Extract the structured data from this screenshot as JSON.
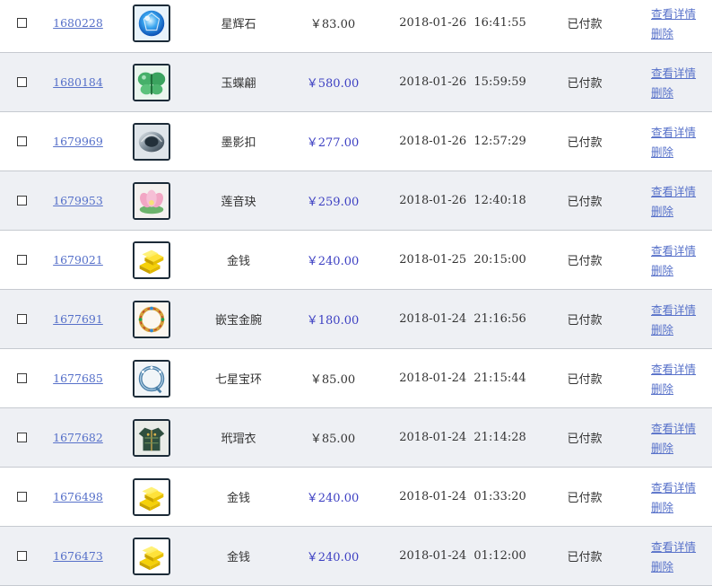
{
  "labels": {
    "view_detail": "查看详情",
    "delete": "删除"
  },
  "orders": [
    {
      "id": "1680228",
      "icon": "blue-gem-icon",
      "name": "星辉石",
      "price": "￥83.00",
      "highlight": false,
      "time": "2018-01-26  16:41:55",
      "status": "已付款"
    },
    {
      "id": "1680184",
      "icon": "jade-butterfly-icon",
      "name": "玉蝶翩",
      "price": "￥580.00",
      "highlight": true,
      "time": "2018-01-26  15:59:59",
      "status": "已付款"
    },
    {
      "id": "1679969",
      "icon": "silver-clasp-icon",
      "name": "墨影扣",
      "price": "￥277.00",
      "highlight": true,
      "time": "2018-01-26  12:57:29",
      "status": "已付款"
    },
    {
      "id": "1679953",
      "icon": "lotus-pendant-icon",
      "name": "莲音玦",
      "price": "￥259.00",
      "highlight": true,
      "time": "2018-01-26  12:40:18",
      "status": "已付款"
    },
    {
      "id": "1679021",
      "icon": "gold-bars-icon",
      "name": "金钱",
      "price": "￥240.00",
      "highlight": true,
      "time": "2018-01-25  20:15:00",
      "status": "已付款"
    },
    {
      "id": "1677691",
      "icon": "jeweled-bracelet-icon",
      "name": "嵌宝金腕",
      "price": "￥180.00",
      "highlight": true,
      "time": "2018-01-24  21:16:56",
      "status": "已付款"
    },
    {
      "id": "1677685",
      "icon": "seven-star-ring-icon",
      "name": "七星宝环",
      "price": "￥85.00",
      "highlight": false,
      "time": "2018-01-24  21:15:44",
      "status": "已付款"
    },
    {
      "id": "1677682",
      "icon": "armor-robe-icon",
      "name": "玳瑁衣",
      "price": "￥85.00",
      "highlight": false,
      "time": "2018-01-24  21:14:28",
      "status": "已付款"
    },
    {
      "id": "1676498",
      "icon": "gold-bars-icon",
      "name": "金钱",
      "price": "￥240.00",
      "highlight": true,
      "time": "2018-01-24  01:33:20",
      "status": "已付款"
    },
    {
      "id": "1676473",
      "icon": "gold-bars-icon",
      "name": "金钱",
      "price": "￥240.00",
      "highlight": true,
      "time": "2018-01-24  01:12:00",
      "status": "已付款"
    }
  ],
  "colors": {
    "link": "#5670c9",
    "price_highlight": "#3c3fc2",
    "row_alt": "#eef0f4",
    "divider": "#c6cad0"
  }
}
